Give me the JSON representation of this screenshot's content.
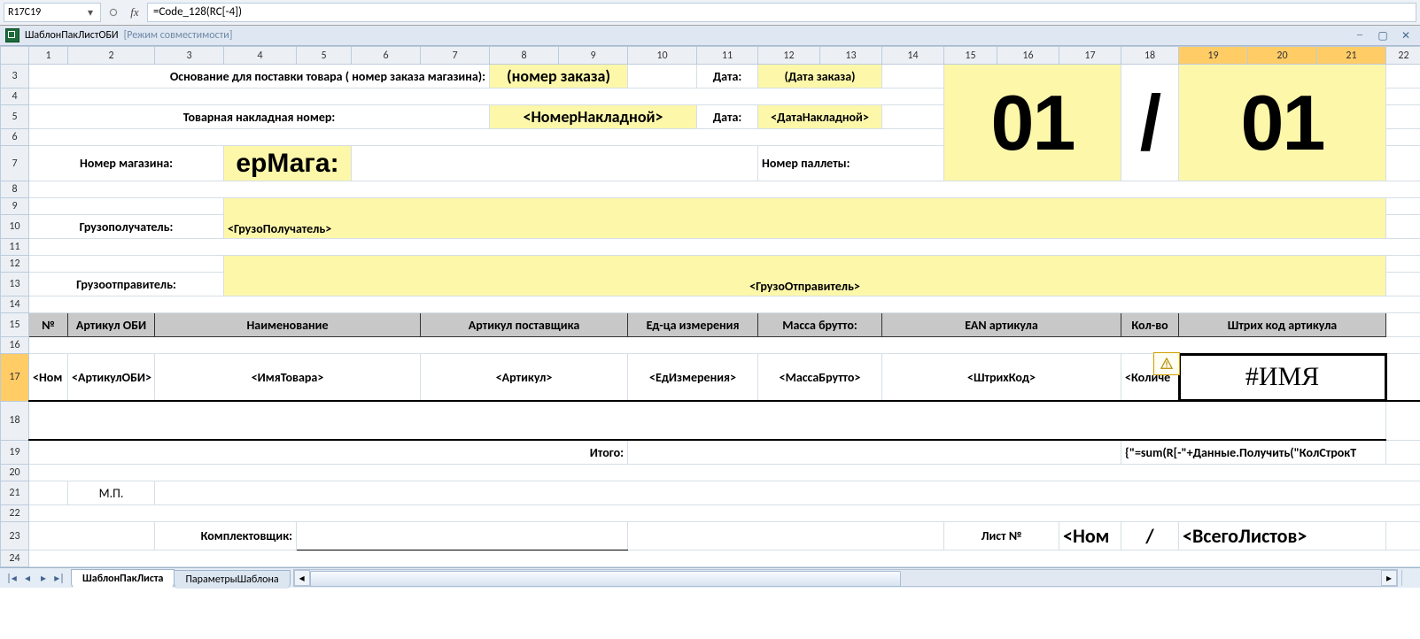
{
  "formula_bar": {
    "cell_ref": "R17C19",
    "formula": "=Code_128(RC[-4])"
  },
  "window": {
    "doc_name": "ШаблонПакЛистОБИ",
    "mode": "[Режим совместимости]"
  },
  "col_headers": [
    "1",
    "2",
    "3",
    "4",
    "5",
    "6",
    "7",
    "8",
    "9",
    "10",
    "11",
    "12",
    "13",
    "14",
    "15",
    "16",
    "17",
    "18",
    "19",
    "20",
    "21",
    "22"
  ],
  "labels": {
    "osnovanie": "Основание для поставки товара ( номер заказа магазина):",
    "nomer_zakaza": "(номер заказа)",
    "data": "Дата:",
    "data_zakaza": "(Дата заказа)",
    "nakladnaya_label": "Товарная накладная номер:",
    "nomer_nakladnoy": "<НомерНакладной>",
    "data_nakladnoy": "<ДатаНакладной>",
    "nomer_magazina_label": "Номер магазина:",
    "nomer_magazina_val": "ерМага:",
    "nomer_pallety": "Номер паллеты:",
    "big01": "01",
    "slash": "/",
    "big01b": "01",
    "gruzopoluchatel_label": "Грузополучатель:",
    "gruzopoluchatel_val": "<ГрузоПолучатель>",
    "gruzootpravitel_label": "Грузоотправитель:",
    "gruzootpravitel_val": "<ГрузоОтправитель>"
  },
  "table_headers": {
    "no": "№",
    "artikul_obi": "Артикул ОБИ",
    "naimenovanie": "Наименование",
    "artikul_postav": "Артикул поставщика",
    "ed_izm": "Ед-ца измерения",
    "massa": "Масса брутто:",
    "ean": "EAN  артикула",
    "kolvo": "Кол-во",
    "shtrih": "Штрих код артикула"
  },
  "data_row": {
    "no": "<Ном",
    "artikul_obi": "<АртикулОБИ>",
    "imya_tovara": "<ИмяТовара>",
    "artikul": "<Артикул>",
    "ed_izm": "<ЕдИзмерения>",
    "massa": "<МассаБрутто>",
    "shtrih": "<ШтрихКод>",
    "kolvo": "<Количе",
    "err": "#ИМЯ"
  },
  "footer": {
    "itogo": "Итого:",
    "sum_formula": "{\"=sum(R[-\"+Данные.Получить(\"КолСтрокТ",
    "mp": "М.П.",
    "komplekt": "Комплектовщик:",
    "list_no": "Лист №",
    "nom": "<Ном",
    "slash": "/",
    "vsego": "<ВсегоЛистов>"
  },
  "tabs": {
    "active": "ШаблонПакЛиста",
    "other": "ПараметрыШаблона"
  }
}
